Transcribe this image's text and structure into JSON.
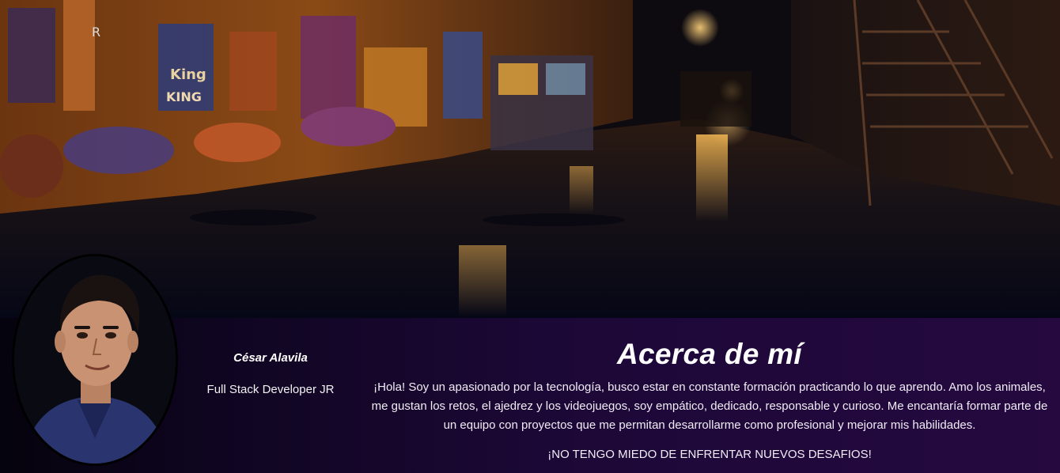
{
  "profile": {
    "name": "César Alavila",
    "role": "Full Stack Developer JR"
  },
  "about": {
    "heading": "Acerca de mí",
    "description": "¡Hola! Soy un apasionado por la tecnología, busco estar en constante formación practicando lo que aprendo. Amo los animales, me gustan los retos, el ajedrez y los videojuegos, soy empático, dedicado, responsable y curioso. Me encantaría formar parte de un equipo con proyectos que me permitan desarrollarme como profesional y mejorar mis habilidades.",
    "motto": "¡NO TENGO MIEDO DE ENFRENTAR NUEVOS DESAFIOS!"
  },
  "graffiti": {
    "tags": [
      "R",
      "King",
      "KING"
    ]
  },
  "colors": {
    "section_background": "#1d0838",
    "text": "#ffffff",
    "accent_glow": "#f2b04a"
  }
}
